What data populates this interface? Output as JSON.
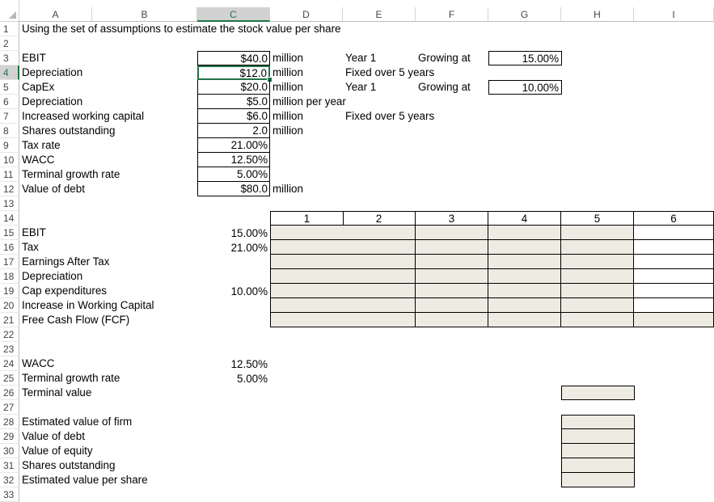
{
  "columns": [
    "A",
    "B",
    "C",
    "D",
    "E",
    "F",
    "G",
    "H",
    "I"
  ],
  "selected_column": "C",
  "rows": [
    "1",
    "2",
    "3",
    "4",
    "5",
    "6",
    "7",
    "8",
    "9",
    "10",
    "11",
    "12",
    "13",
    "14",
    "15",
    "16",
    "17",
    "18",
    "19",
    "20",
    "21",
    "22",
    "23",
    "24",
    "25",
    "26",
    "27",
    "28",
    "29",
    "30",
    "31",
    "32",
    "33"
  ],
  "selected_row": "4",
  "title": "Using the set of assumptions to estimate the stock value per share",
  "assumptions": [
    {
      "row": "3",
      "label": "EBIT",
      "value": "$40.0",
      "unit": "million",
      "note1": "Year 1",
      "note2": "Growing at",
      "rate": "15.00%"
    },
    {
      "row": "4",
      "label": "Depreciation",
      "value": "$12.0",
      "unit": "million",
      "note1": "Fixed over 5 years",
      "note2": "",
      "rate": ""
    },
    {
      "row": "5",
      "label": "CapEx",
      "value": "$20.0",
      "unit": "million",
      "note1": "Year 1",
      "note2": "Growing at",
      "rate": "10.00%"
    },
    {
      "row": "6",
      "label": "Depreciation",
      "value": "$5.0",
      "unit": "million per year",
      "note1": "",
      "note2": "",
      "rate": ""
    },
    {
      "row": "7",
      "label": "Increased working capital",
      "value": "$6.0",
      "unit": "million",
      "note1": "Fixed over 5 years",
      "note2": "",
      "rate": ""
    },
    {
      "row": "8",
      "label": "Shares outstanding",
      "value": "2.0",
      "unit": "million",
      "note1": "",
      "note2": "",
      "rate": ""
    },
    {
      "row": "9",
      "label": "Tax rate",
      "value": "21.00%",
      "unit": "",
      "note1": "",
      "note2": "",
      "rate": ""
    },
    {
      "row": "10",
      "label": "WACC",
      "value": "12.50%",
      "unit": "",
      "note1": "",
      "note2": "",
      "rate": ""
    },
    {
      "row": "11",
      "label": "Terminal growth rate",
      "value": "5.00%",
      "unit": "",
      "note1": "",
      "note2": "",
      "rate": ""
    },
    {
      "row": "12",
      "label": "Value of debt",
      "value": "$80.0",
      "unit": "million",
      "note1": "",
      "note2": "",
      "rate": ""
    }
  ],
  "year_headers": [
    "1",
    "2",
    "3",
    "4",
    "5",
    "6"
  ],
  "fcf_rows": [
    {
      "label": "EBIT",
      "rate": "15.00%"
    },
    {
      "label": "Tax",
      "rate": "21.00%"
    },
    {
      "label": "Earnings After Tax",
      "rate": ""
    },
    {
      "label": "Depreciation",
      "rate": ""
    },
    {
      "label": "Cap expenditures",
      "rate": "10.00%"
    },
    {
      "label": "Increase in Working Capital",
      "rate": ""
    },
    {
      "label": "Free Cash Flow (FCF)",
      "rate": ""
    }
  ],
  "terminal": [
    {
      "label": "WACC",
      "rate": "12.50%"
    },
    {
      "label": "Terminal growth rate",
      "rate": "5.00%"
    },
    {
      "label": "Terminal value",
      "rate": ""
    }
  ],
  "valuation": [
    {
      "label": "Estimated value of firm"
    },
    {
      "label": "Value of debt"
    },
    {
      "label": "Value of equity"
    },
    {
      "label": "Shares outstanding"
    },
    {
      "label": "Estimated value per share"
    }
  ]
}
